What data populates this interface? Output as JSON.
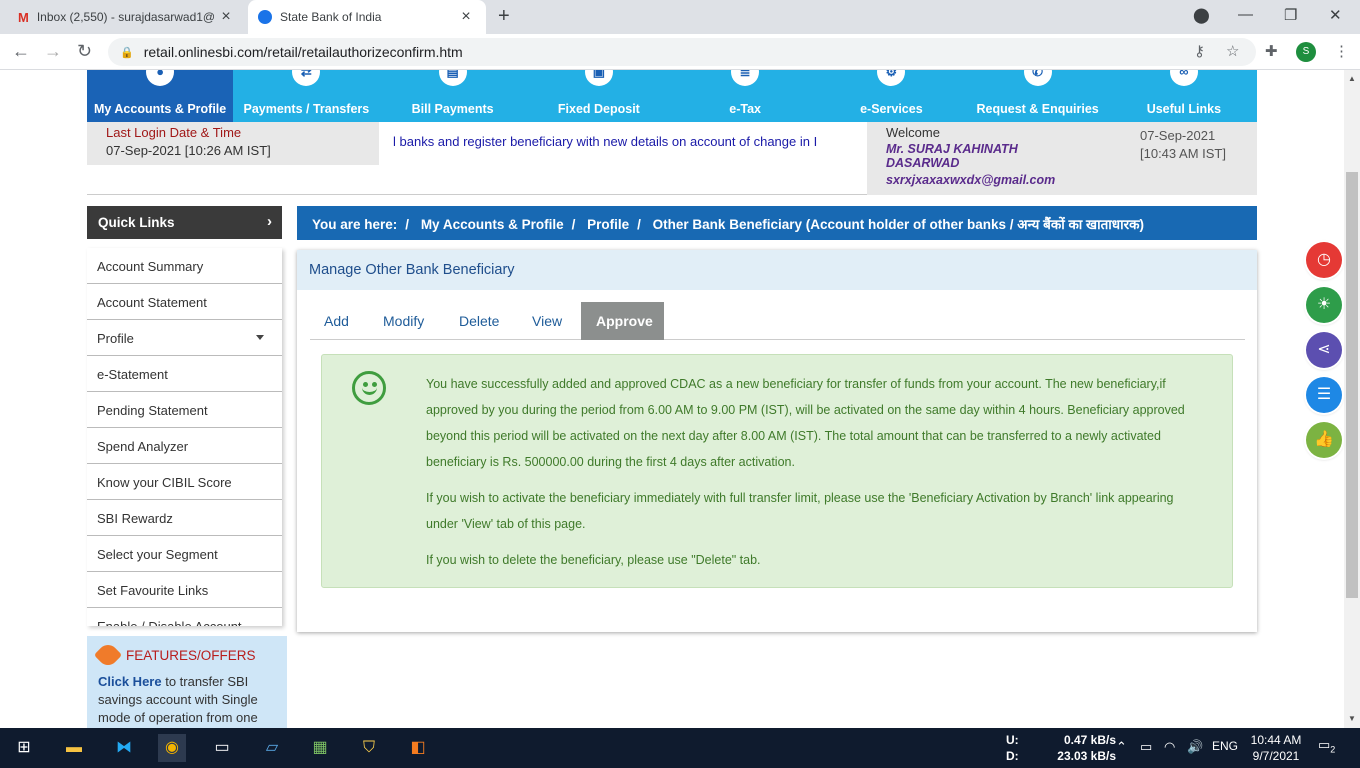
{
  "browser": {
    "tabs": [
      {
        "title": "Inbox (2,550) - surajdasarwad1@",
        "icon": "gmail-icon"
      },
      {
        "title": "State Bank of India",
        "icon": "sbi-icon"
      }
    ],
    "url": "retail.onlinesbi.com/retail/retailauthorizeconfirm.htm",
    "profile_initial": "S"
  },
  "main_nav": [
    {
      "label": "My Accounts & Profile",
      "selected": true
    },
    {
      "label": "Payments / Transfers"
    },
    {
      "label": "Bill Payments"
    },
    {
      "label": "Fixed Deposit"
    },
    {
      "label": "e-Tax"
    },
    {
      "label": "e-Services"
    },
    {
      "label": "Request & Enquiries"
    },
    {
      "label": "Useful Links"
    }
  ],
  "last_login": {
    "heading": "Last Login Date & Time",
    "value": "07-Sep-2021 [10:26 AM IST]"
  },
  "ticker": "l banks and register beneficiary with new details on account of change in I",
  "welcome": {
    "label": "Welcome",
    "name": "Mr. SURAJ KAHINATH DASARWAD",
    "email": "sxrxjxaxaxwxdx@gmail.com",
    "date": "07-Sep-2021",
    "time": "[10:43 AM IST]"
  },
  "quick_links": {
    "title": "Quick Links",
    "items": [
      "Account Summary",
      "Account Statement",
      "Profile",
      "e-Statement",
      "Pending Statement",
      "Spend Analyzer",
      "Know your CIBIL Score",
      "SBI Rewardz",
      "Select your Segment",
      "Set Favourite Links",
      "Enable / Disable Account"
    ]
  },
  "features": {
    "title": "FEATURES/OFFERS",
    "link": "Click Here",
    "text": " to transfer SBI savings account with Single mode of operation from one"
  },
  "breadcrumb": {
    "prefix": "You are here:",
    "items": [
      "My Accounts & Profile",
      "Profile",
      "Other Bank Beneficiary (Account holder of other banks / अन्य बैंकों का खाताधारक)"
    ]
  },
  "panel": {
    "title": "Manage Other Bank Beneficiary",
    "tabs": [
      "Add",
      "Modify",
      "Delete",
      "View",
      "Approve"
    ],
    "selected_tab": "Approve",
    "messages": [
      "You have successfully added and approved CDAC as a new beneficiary for transfer of funds from your account. The new beneficiary,if approved by you during the period from 6.00 AM to 9.00 PM (IST), will be activated on the same day within 4 hours. Beneficiary approved beyond this period will be activated on the next day after 8.00 AM (IST). The total amount that can be transferred to a newly activated beneficiary is Rs. 500000.00 during the first 4 days after activation.",
      "If you wish to activate the beneficiary immediately with full transfer limit, please use the 'Beneficiary Activation by Branch' link appearing under 'View' tab of this page.",
      "If you wish to delete the beneficiary, please use \"Delete\" tab."
    ]
  },
  "side_buttons": [
    {
      "name": "time-icon",
      "color": "#e53935"
    },
    {
      "name": "bulb-icon",
      "color": "#2e9d4a"
    },
    {
      "name": "share-icon",
      "color": "#5c4fb0"
    },
    {
      "name": "list-icon",
      "color": "#1e88e5"
    },
    {
      "name": "thumbs-up-icon",
      "color": "#7cb342"
    }
  ],
  "taskbar": {
    "upload_label": "U:",
    "upload": "0.47 kB/s",
    "download_label": "D:",
    "download": "23.03 kB/s",
    "language": "ENG",
    "time": "10:44 AM",
    "date": "9/7/2021",
    "notifications": "2"
  }
}
